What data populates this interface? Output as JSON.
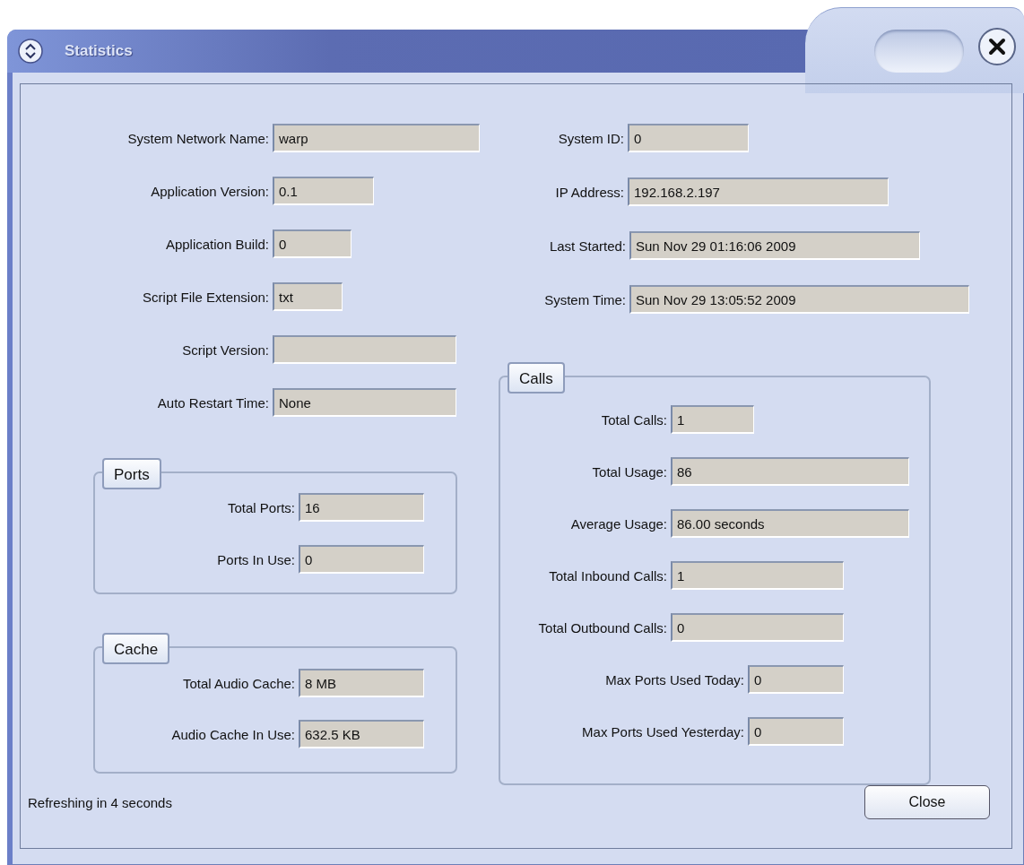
{
  "window": {
    "title": "Statistics"
  },
  "left_fields": [
    {
      "label": "System  Network Name:",
      "value": "warp"
    },
    {
      "label": "Application Version:",
      "value": "0.1"
    },
    {
      "label": "Application Build:",
      "value": "0"
    },
    {
      "label": "Script File Extension:",
      "value": "txt"
    },
    {
      "label": "Script Version:"
    },
    {
      "label": "Auto Restart Time:",
      "value": "None"
    }
  ],
  "right_fields": [
    {
      "label": "System ID:",
      "value": "0"
    },
    {
      "label": "IP Address:",
      "value": "192.168.2.197"
    },
    {
      "label": "Last Started:",
      "value": "Sun Nov 29 01:16:06 2009"
    },
    {
      "label": "System Time:",
      "value": "Sun Nov 29 13:05:52 2009"
    }
  ],
  "ports": {
    "title": "Ports",
    "fields": [
      {
        "label": "Total Ports:",
        "value": "16"
      },
      {
        "label": "Ports In Use:",
        "value": "0"
      }
    ]
  },
  "cache": {
    "title": "Cache",
    "fields": [
      {
        "label": "Total Audio Cache:",
        "value": "8 MB"
      },
      {
        "label": "Audio Cache In Use:",
        "value": "632.5 KB"
      }
    ]
  },
  "calls": {
    "title": "Calls",
    "fields": [
      {
        "label": "Total Calls:",
        "value": "1"
      },
      {
        "label": "Total Usage:",
        "value": "86"
      },
      {
        "label": "Average Usage:",
        "value": "86.00 seconds"
      },
      {
        "label": "Total Inbound Calls:",
        "value": "1"
      },
      {
        "label": "Total Outbound Calls:",
        "value": "0"
      },
      {
        "label": "Max Ports Used Today:",
        "value": "0"
      },
      {
        "label": "Max Ports Used Yesterday:",
        "value": "0"
      }
    ]
  },
  "status": "Refreshing in 4 seconds",
  "buttons": [
    "Close"
  ]
}
